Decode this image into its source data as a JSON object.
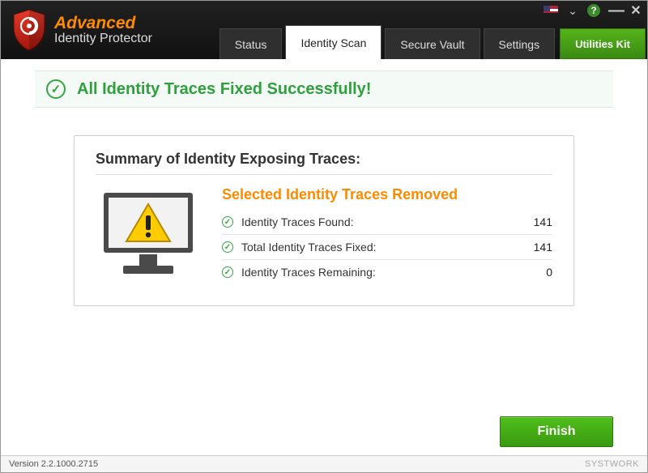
{
  "app": {
    "title_top": "Advanced",
    "title_bottom": "Identity Protector"
  },
  "titlebar": {
    "flag": "us",
    "dropdown_icon": "chevron-down",
    "help_label": "?",
    "minimize_label": "—",
    "close_label": "✕"
  },
  "tabs": {
    "status": "Status",
    "identity_scan": "Identity Scan",
    "secure_vault": "Secure Vault",
    "settings": "Settings",
    "utilities_kit": "Utilities Kit",
    "active": "identity_scan"
  },
  "banner": {
    "message": "All Identity Traces Fixed Successfully!"
  },
  "summary": {
    "heading": "Summary of Identity Exposing Traces:",
    "removed_title": "Selected Identity Traces Removed",
    "rows": {
      "found": {
        "label": "Identity Traces Found:",
        "value": "141"
      },
      "fixed": {
        "label": "Total Identity Traces Fixed:",
        "value": "141"
      },
      "remaining": {
        "label": "Identity Traces Remaining:",
        "value": "0"
      }
    }
  },
  "actions": {
    "finish": "Finish"
  },
  "statusbar": {
    "version": "Version 2.2.1000.2715",
    "watermark": "SYSTWORK"
  }
}
